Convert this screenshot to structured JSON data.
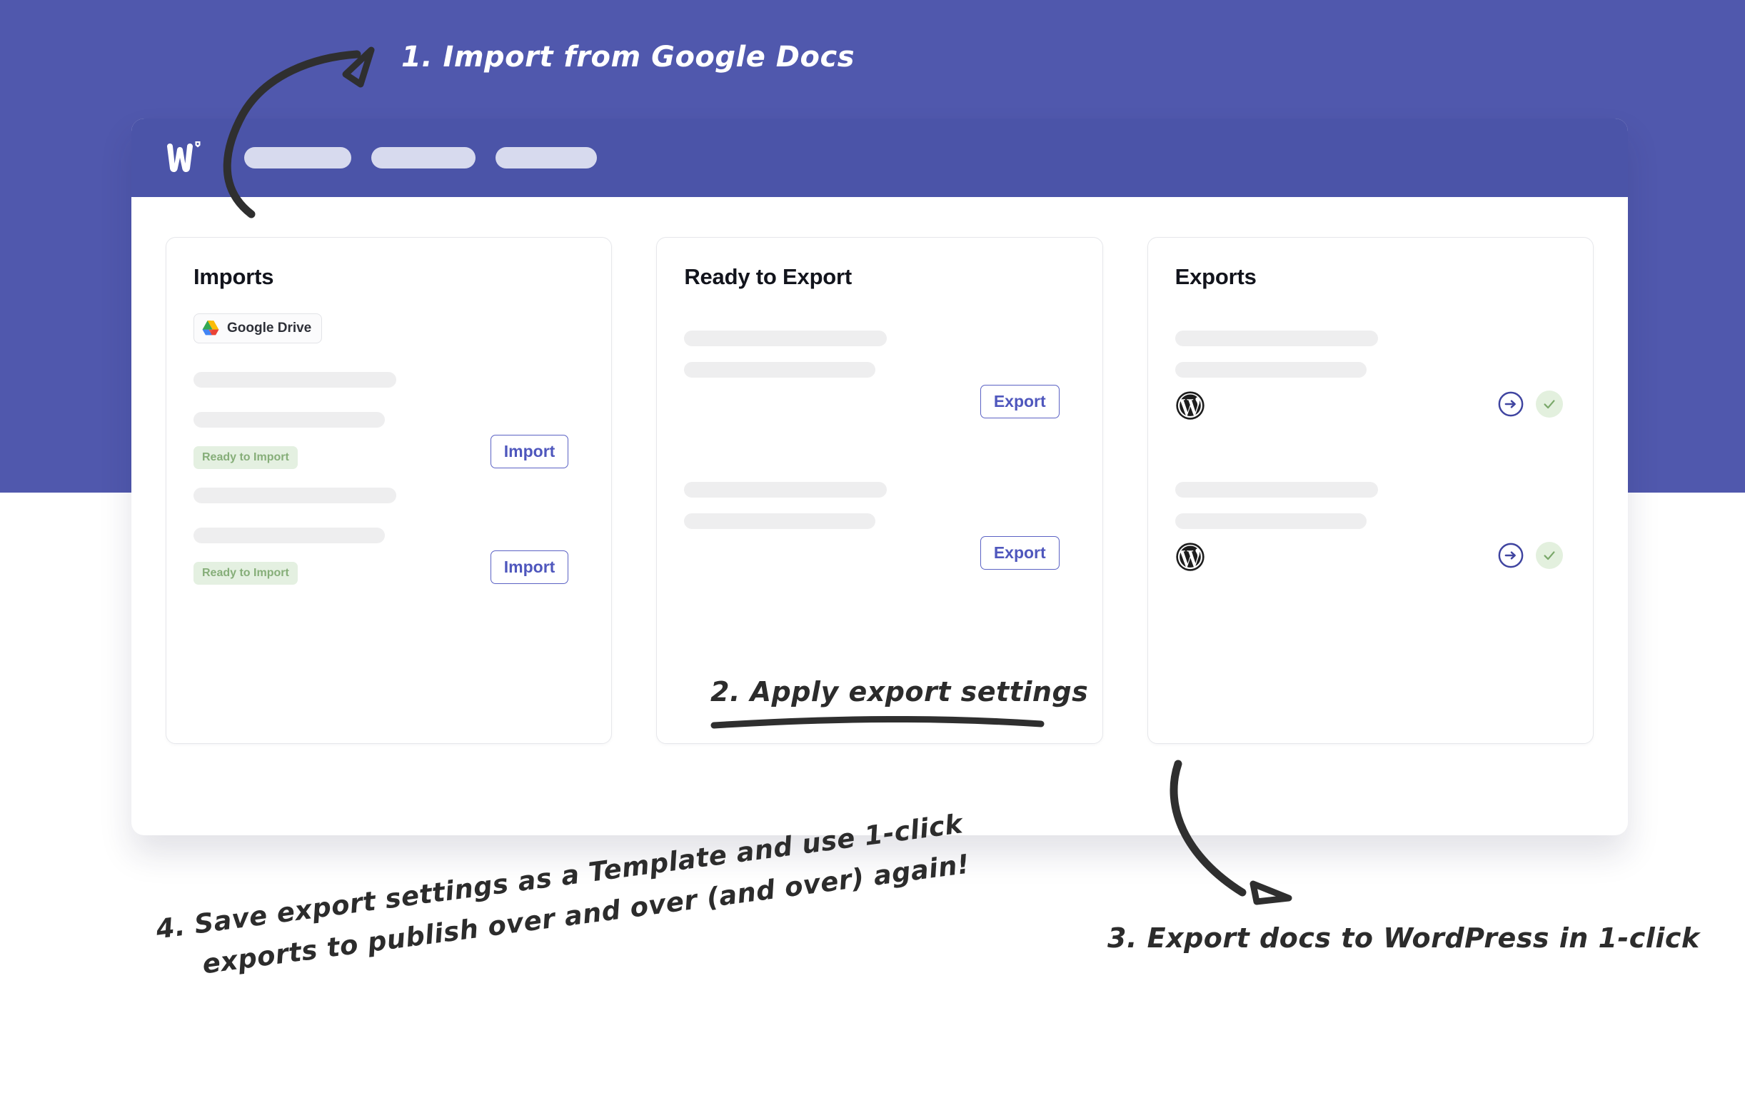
{
  "theme": {
    "purple_bg": "#5058ad",
    "header_bg": "#4b54a8",
    "accent_indigo": "#5b62c4",
    "badge_green_bg": "#e4f0e1",
    "badge_green_text": "#86ae79",
    "skeleton_gray": "#eeeeef",
    "check_green": "#7aa86a"
  },
  "app": {
    "logo_name": "wordable-logo",
    "nav_pills": [
      "",
      "",
      ""
    ]
  },
  "cards": [
    {
      "id": "imports",
      "title": "Imports",
      "source_chip": {
        "label": "Google Drive",
        "icon": "google-drive-icon"
      },
      "rows": [
        {
          "badge": "Ready to Import",
          "button": "Import"
        },
        {
          "badge": "Ready to Import",
          "button": "Import"
        }
      ]
    },
    {
      "id": "ready-to-export",
      "title": "Ready to Export",
      "rows": [
        {
          "button": "Export"
        },
        {
          "button": "Export"
        }
      ]
    },
    {
      "id": "exports",
      "title": "Exports",
      "rows": [
        {
          "platform_icon": "wordpress-icon",
          "action_icon": "arrow-right-circle-icon",
          "status_icon": "check-circle-icon"
        },
        {
          "platform_icon": "wordpress-icon",
          "action_icon": "arrow-right-circle-icon",
          "status_icon": "check-circle-icon"
        }
      ]
    }
  ],
  "annotations": {
    "step1": "1. Import from Google Docs",
    "step2": "2. Apply export settings",
    "step3": "3. Export docs to WordPress in 1-click",
    "step4_line1": "4. Save export settings as a Template and use 1-click",
    "step4_line2": "exports to publish over and over (and over) again!"
  }
}
